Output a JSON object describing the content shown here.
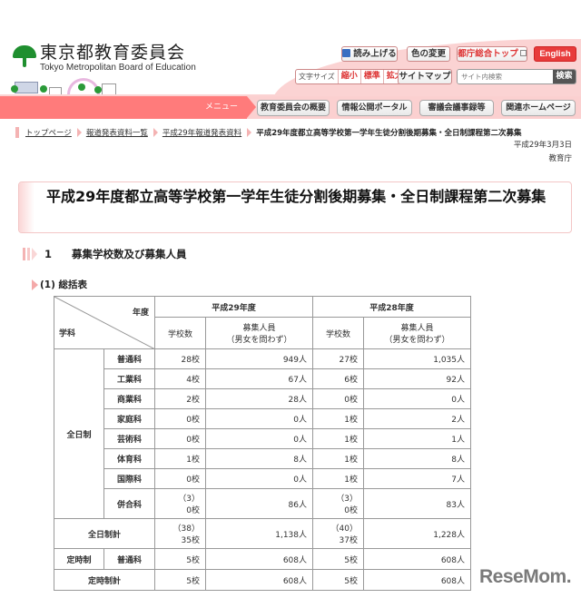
{
  "header": {
    "org_name_ja": "東京都教育委員会",
    "org_name_en": "Tokyo Metropolitan Board of Education",
    "tools": {
      "read_aloud": "読み上げる",
      "color_change": "色の変更",
      "tocho_top": "都庁総合トップ",
      "english": "English",
      "font_size_label": "文字サイズ",
      "font_small": "縮小",
      "font_standard": "標準",
      "font_large": "拡大",
      "sitemap": "サイトマップ",
      "search_placeholder": "サイト内検索",
      "search_button": "検索"
    },
    "colors": {
      "accent": "#ff7b7b",
      "english_button": "#e83b3b",
      "pink_bg": "#fbd3d3"
    }
  },
  "menu": {
    "label": "メニュー",
    "items": [
      {
        "label": "教育委員会の概要"
      },
      {
        "label": "情報公開ポータル"
      },
      {
        "label": "審議会議事録等"
      },
      {
        "label": "関連ホームページ"
      }
    ]
  },
  "breadcrumb": {
    "items": [
      {
        "label": "トップページ"
      },
      {
        "label": "報道発表資料一覧"
      },
      {
        "label": "平成29年報道発表資料"
      }
    ],
    "current": "平成29年度都立高等学校第一学年生徒分割後期募集・全日制課程第二次募集"
  },
  "meta": {
    "date": "平成29年3月3日",
    "organization": "教育庁"
  },
  "page_title": "平成29年度都立高等学校第一学年生徒分割後期募集・全日制課程第二次募集",
  "section": {
    "number": "1",
    "title": "募集学校数及び募集人員"
  },
  "subsection": {
    "title": "(1) 総括表"
  },
  "table": {
    "corner_top": "年度",
    "corner_bottom": "学科",
    "year_headers": [
      "平成29年度",
      "平成28年度"
    ],
    "col_schools": "学校数",
    "col_capacity_line1": "募集人員",
    "col_capacity_line2": "（男女を問わず）",
    "fulltime_label": "全日制",
    "fulltime_rows": [
      {
        "subject": "普通科",
        "h29_schools": "28校",
        "h29_capacity": "949人",
        "h28_schools": "27校",
        "h28_capacity": "1,035人"
      },
      {
        "subject": "工業科",
        "h29_schools": "4校",
        "h29_capacity": "67人",
        "h28_schools": "6校",
        "h28_capacity": "92人"
      },
      {
        "subject": "商業科",
        "h29_schools": "2校",
        "h29_capacity": "28人",
        "h28_schools": "0校",
        "h28_capacity": "0人"
      },
      {
        "subject": "家庭科",
        "h29_schools": "0校",
        "h29_capacity": "0人",
        "h28_schools": "1校",
        "h28_capacity": "2人"
      },
      {
        "subject": "芸術科",
        "h29_schools": "0校",
        "h29_capacity": "0人",
        "h28_schools": "1校",
        "h28_capacity": "1人"
      },
      {
        "subject": "体育科",
        "h29_schools": "1校",
        "h29_capacity": "8人",
        "h28_schools": "1校",
        "h28_capacity": "8人"
      },
      {
        "subject": "国際科",
        "h29_schools": "0校",
        "h29_capacity": "0人",
        "h28_schools": "1校",
        "h28_capacity": "7人"
      }
    ],
    "combined_row": {
      "subject": "併合科",
      "h29_schools_paren": "（3）",
      "h29_schools": "0校",
      "h29_capacity": "86人",
      "h28_schools_paren": "（3）",
      "h28_schools": "0校",
      "h28_capacity": "83人"
    },
    "fulltime_total": {
      "label": "全日制計",
      "h29_schools_paren": "（38）",
      "h29_schools": "35校",
      "h29_capacity": "1,138人",
      "h28_schools_paren": "（40）",
      "h28_schools": "37校",
      "h28_capacity": "1,228人"
    },
    "parttime_row": {
      "label": "定時制",
      "subject": "普通科",
      "h29_schools": "5校",
      "h29_capacity": "608人",
      "h28_schools": "5校",
      "h28_capacity": "608人"
    },
    "parttime_total": {
      "label": "定時制計",
      "h29_schools": "5校",
      "h29_capacity": "608人",
      "h28_schools": "5校",
      "h28_capacity": "608人"
    }
  },
  "watermark": "ReseMom."
}
